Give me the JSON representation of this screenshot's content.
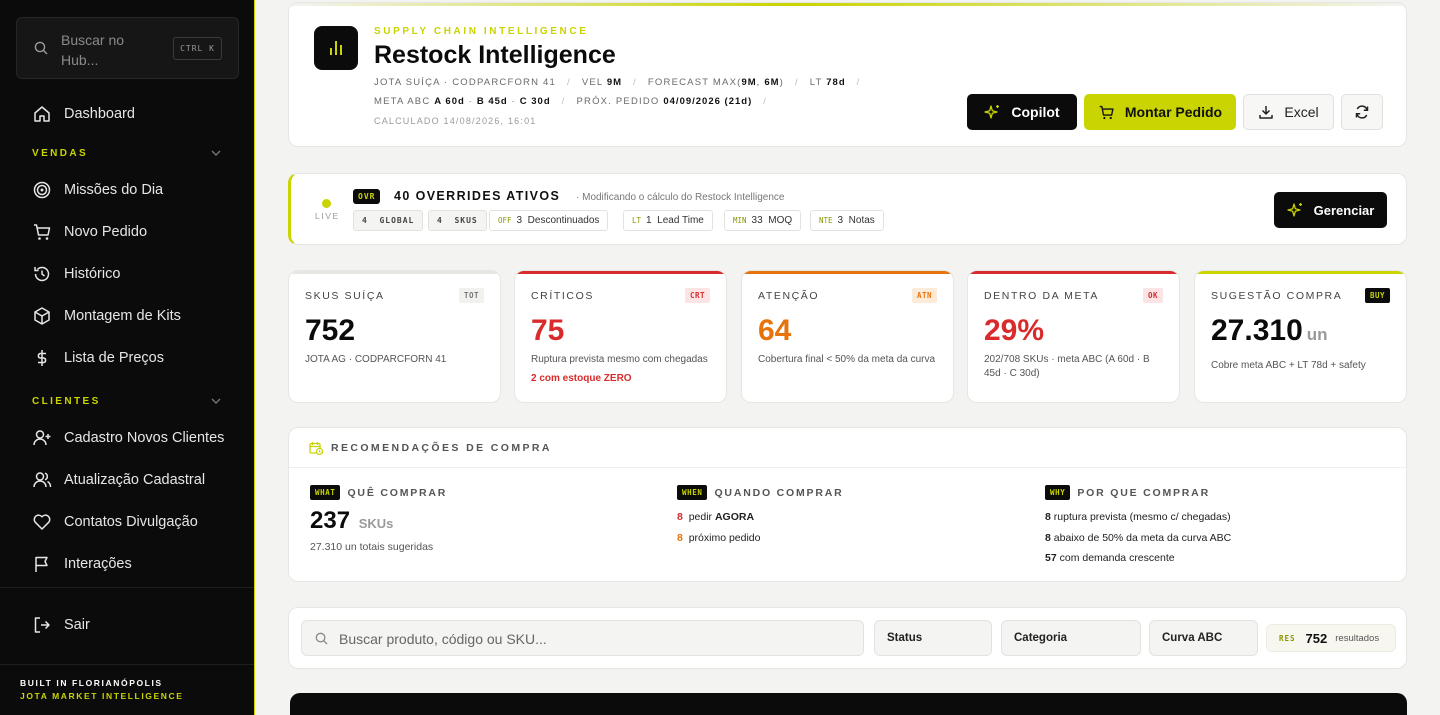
{
  "sidebar": {
    "search_placeholder": "Buscar no Hub...",
    "search_shortcut": "CTRL K",
    "dashboard": "Dashboard",
    "vendas_title": "VENDAS",
    "vendas_items": [
      "Missões do Dia",
      "Novo Pedido",
      "Histórico",
      "Montagem de Kits",
      "Lista de Preços"
    ],
    "clientes_title": "CLIENTES",
    "clientes_items": [
      "Cadastro Novos Clientes",
      "Atualização Cadastral",
      "Contatos Divulgação",
      "Interações"
    ],
    "logout": "Sair",
    "footer_line1": "BUILT IN FLORIANÓPOLIS",
    "footer_line2": "JOTA MARKET INTELLIGENCE",
    "accent_color": "#c9d400"
  },
  "header": {
    "eyebrow": "SUPPLY CHAIN INTELLIGENCE",
    "title": "Restock Intelligence",
    "meta1_a": "JOTA SUÍÇA · CODPARCFORN 41",
    "meta1_b_label": "VEL",
    "meta1_b_value": "9M",
    "meta1_c_label": "FORECAST MAX(",
    "meta1_c_value1": "9M",
    "meta1_c_mid": ", ",
    "meta1_c_value2": "6M",
    "meta1_c_end": ")",
    "meta1_d_label": "LT",
    "meta1_d_value": "78d",
    "meta2_a_label": "META ABC",
    "meta2_a_value1": "A 60d",
    "meta2_a_value2": "B 45d",
    "meta2_a_value3": "C 30d",
    "meta2_b_label": "PRÓX. PEDIDO",
    "meta2_b_value": "04/09/2026 (21d)",
    "calculated": "CALCULADO 14/08/2026, 16:01",
    "btn_copilot": "Copilot",
    "btn_montar": "Montar Pedido",
    "btn_excel": "Excel"
  },
  "overrides": {
    "live": "LIVE",
    "badge": "OVR",
    "title": "40 OVERRIDES ATIVOS",
    "subtitle": "· Modificando o cálculo do Restock Intelligence",
    "chips": [
      {
        "tag": "",
        "count": "4",
        "label": "GLOBAL"
      },
      {
        "tag": "",
        "count": "4",
        "label": "SKUS"
      },
      {
        "tag": "OFF",
        "count": "3",
        "label": "Descontinuados"
      },
      {
        "tag": "LT",
        "count": "1",
        "label": "Lead Time"
      },
      {
        "tag": "MIN",
        "count": "33",
        "label": "MOQ"
      },
      {
        "tag": "NTE",
        "count": "3",
        "label": "Notas"
      }
    ],
    "btn_manage": "Gerenciar"
  },
  "kpis": [
    {
      "label": "SKUS SUÍÇA",
      "tag": "TOT",
      "value": "752",
      "unit": "",
      "note": "JOTA AG · CODPARCFORN 41",
      "warn": "",
      "color": "#e6e6e2",
      "value_color": "#0b0b0b",
      "tag_bg": "#f1f1ee",
      "tag_fg": "#777"
    },
    {
      "label": "CRÍTICOS",
      "tag": "CRT",
      "value": "75",
      "unit": "",
      "note": "Ruptura prevista mesmo com chegadas",
      "warn": "2 com estoque ZERO",
      "color": "#d92b2b",
      "value_color": "#d92b2b",
      "tag_bg": "#fde4e4",
      "tag_fg": "#d92b2b"
    },
    {
      "label": "ATENÇÃO",
      "tag": "ATN",
      "value": "64",
      "unit": "",
      "note": "Cobertura final < 50% da meta da curva",
      "warn": "",
      "color": "#e8730c",
      "value_color": "#e8730c",
      "tag_bg": "#fdebd9",
      "tag_fg": "#e8730c"
    },
    {
      "label": "DENTRO DA META",
      "tag": "OK",
      "value": "29%",
      "unit": "",
      "note": "202/708 SKUs · meta ABC (A 60d · B 45d · C 30d)",
      "warn": "",
      "color": "#d92b2b",
      "value_color": "#d92b2b",
      "tag_bg": "#fde4e4",
      "tag_fg": "#d92b2b"
    },
    {
      "label": "SUGESTÃO COMPRA",
      "tag": "BUY",
      "value": "27.310",
      "unit": "un",
      "note": "Cobre meta ABC + LT 78d + safety",
      "warn": "",
      "color": "#c9d400",
      "value_color": "#0b0b0b",
      "tag_bg": "#0b0b0b",
      "tag_fg": "#c9d400"
    }
  ],
  "recommendations": {
    "title": "RECOMENDAÇÕES DE COMPRA",
    "what_badge": "WHAT",
    "what_title": "QUÊ COMPRAR",
    "what_value": "237",
    "what_unit": "SKUs",
    "what_note": "27.310 un totais sugeridas",
    "when_badge": "WHEN",
    "when_title": "QUANDO COMPRAR",
    "when_lines": [
      {
        "n": "8",
        "pre": "pedir ",
        "strong": "AGORA"
      },
      {
        "n": "8",
        "pre": "próximo pedido",
        "strong": ""
      }
    ],
    "why_badge": "WHY",
    "why_title": "POR QUE COMPRAR",
    "why_lines": [
      {
        "n": "8",
        "text": "ruptura prevista (mesmo c/ chegadas)"
      },
      {
        "n": "8",
        "text": "abaixo de 50% da meta da curva ABC"
      },
      {
        "n": "57",
        "text": "com demanda crescente"
      }
    ]
  },
  "filters": {
    "search_placeholder": "Buscar produto, código ou SKU...",
    "status": "Status",
    "categoria": "Categoria",
    "curva": "Curva ABC",
    "res_tag": "RES",
    "res_count": "752",
    "res_label": "resultados"
  }
}
